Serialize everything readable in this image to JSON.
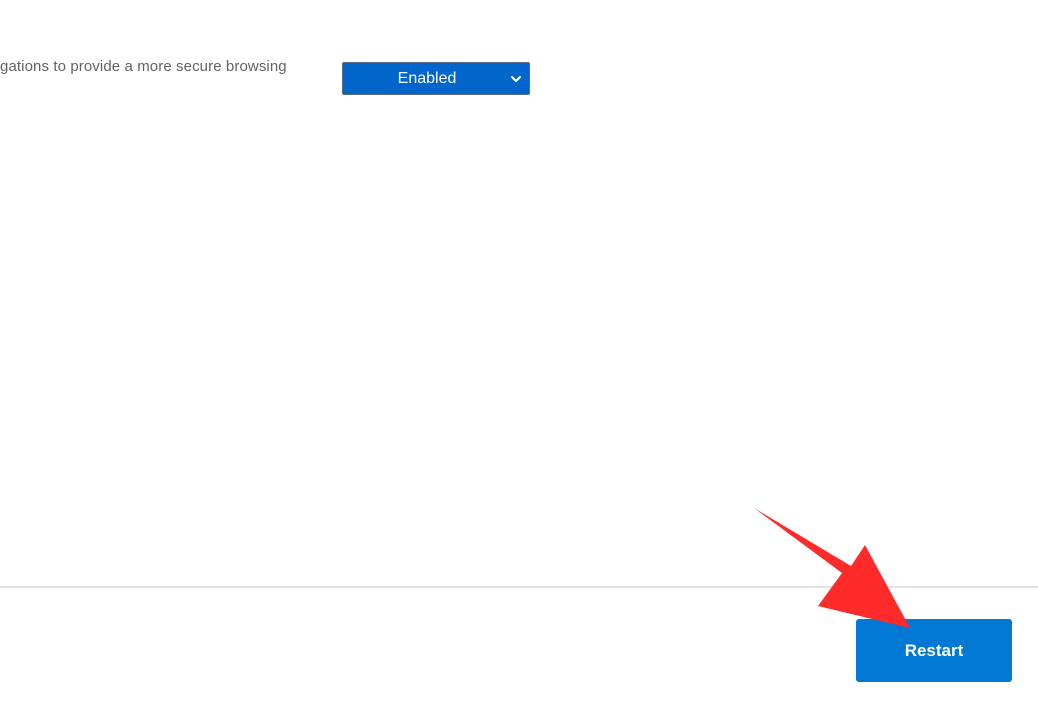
{
  "flag": {
    "description_fragment": "gations to provide a more secure browsing",
    "selected_value": "Enabled",
    "icon": "chevron-down-icon"
  },
  "footer": {
    "restart_label": "Restart"
  },
  "annotation": {
    "icon": "red-pointer-arrow",
    "color": "#ff2b2b"
  },
  "colors": {
    "select_background": "#0066cc",
    "button_background": "#0078d4",
    "description_text": "#5f6368"
  }
}
